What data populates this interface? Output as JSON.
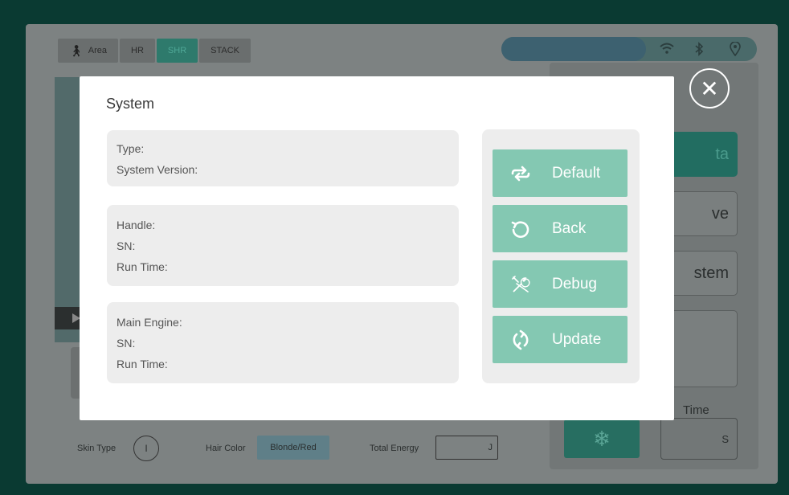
{
  "background": {
    "tabs": [
      {
        "label": "Area",
        "icon": "person-icon"
      },
      {
        "label": "HR"
      },
      {
        "label": "SHR"
      },
      {
        "label": "STACK"
      }
    ],
    "right_buttons": [
      {
        "label": "ta"
      },
      {
        "label": "ve"
      },
      {
        "label": "stem"
      },
      {
        "label": ""
      }
    ],
    "time_label": "Time",
    "time_unit": "S",
    "skin_type_label": "Skin Type",
    "skin_type_value": "I",
    "hair_color_label": "Hair Color",
    "hair_color_value": "Blonde/Red",
    "total_energy_label": "Total Energy",
    "total_energy_unit": "J"
  },
  "dialog": {
    "title": "System",
    "cards": [
      {
        "lines": [
          "Type:",
          "System Version:"
        ]
      },
      {
        "lines": [
          "Handle:",
          "SN:",
          "Run Time:"
        ]
      },
      {
        "lines": [
          "Main Engine:",
          "SN:",
          "Run Time:"
        ]
      }
    ],
    "actions": [
      {
        "label": "Default",
        "icon": "cycle-arrows-icon"
      },
      {
        "label": "Back",
        "icon": "undo-circle-icon"
      },
      {
        "label": "Debug",
        "icon": "tools-icon"
      },
      {
        "label": "Update",
        "icon": "refresh-icon"
      }
    ],
    "close_icon": "close-icon"
  },
  "colors": {
    "accent": "#84c8b2",
    "card_bg": "#ededed",
    "dim_teal": "#226d61"
  }
}
